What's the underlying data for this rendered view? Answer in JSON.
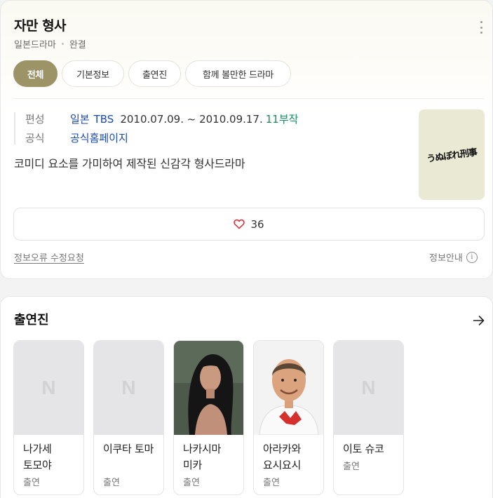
{
  "header": {
    "title": "자만 형사",
    "genre": "일본드라마",
    "status": "완결"
  },
  "tabs": [
    {
      "label": "전체",
      "active": true
    },
    {
      "label": "기본정보",
      "active": false
    },
    {
      "label": "출연진",
      "active": false
    },
    {
      "label": "함께 볼만한 드라마",
      "active": false
    }
  ],
  "info": {
    "broadcast_label": "편성",
    "broadcast_country": "일본",
    "broadcast_channel": "TBS",
    "broadcast_period": "2010.07.09. ~ 2010.09.17.",
    "broadcast_episodes": "11부작",
    "official_label": "공식",
    "official_link": "공식홈페이지",
    "description": "코미디 요소를 가미하여 제작된 신감각 형사드라마"
  },
  "poster": {
    "text": "うぬぼれ刑事",
    "bg": "#eae9d3"
  },
  "like": {
    "count": "36",
    "icon": "heart-icon"
  },
  "footer": {
    "report": "정보오류 수정요청",
    "guide": "정보안내",
    "guide_icon": "info-icon"
  },
  "cast_section": {
    "title": "출연진",
    "arrow_icon": "arrow-right-icon",
    "members": [
      {
        "name": "나가세 토모야",
        "role": "출연",
        "photo": "placeholder"
      },
      {
        "name": "이쿠타 토마",
        "role": "출연",
        "photo": "placeholder"
      },
      {
        "name": "나카시마 미카",
        "role": "출연",
        "photo": "portrait"
      },
      {
        "name": "아라카와 요시요시",
        "role": "출연",
        "photo": "portrait"
      },
      {
        "name": "이토 슈코",
        "role": "출연",
        "photo": "placeholder"
      }
    ]
  },
  "colors": {
    "accent": "#9c9466",
    "link": "#1d4aa8",
    "episodes": "#13905c",
    "heart": "#e0323b"
  }
}
